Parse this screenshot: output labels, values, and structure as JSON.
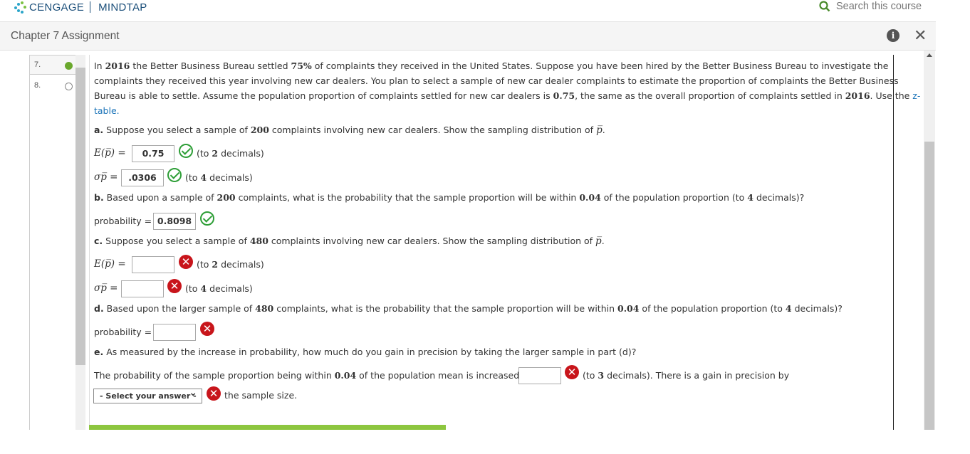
{
  "header": {
    "brand": "CENGAGE",
    "product": "MINDTAP",
    "search_placeholder": "Search this course"
  },
  "assignment": {
    "title": "Chapter 7 Assignment"
  },
  "nav": {
    "items": [
      {
        "number": "7.",
        "status": "complete"
      },
      {
        "number": "8.",
        "status": "incomplete"
      }
    ]
  },
  "question": {
    "intro": {
      "line1_a": "In ",
      "y1": "2016",
      "line1_b": " the Better Business Bureau settled ",
      "p1": "75%",
      "line1_c": " of complaints they received in the United States. Suppose you have been hired by the Better Business Bureau to investigate the",
      "line2": "complaints they received this year involving new car dealers. You plan to select a sample of new car dealer complaints to estimate the proportion of complaints the Better Business",
      "line3_a": "Bureau is able to settle. Assume the population proportion of complaints settled for new car dealers is ",
      "p2": "0.75",
      "line3_b": ", the same as the overall proportion of complaints settled in ",
      "y2": "2016",
      "line3_c": ". Use the ",
      "z": "z-",
      "line4": "table."
    },
    "part_a": {
      "prefix": "a.",
      "text": " Suppose you select a sample of ",
      "n": "200",
      "text2": " complaints involving new car dealers. Show the sampling distribution of ",
      "pbar": "p̅",
      "end": ".",
      "e_label": "E(p̅) =",
      "e_value": "0.75",
      "e_hint_a": "(to ",
      "e_hint_n": "2",
      "e_hint_b": " decimals)",
      "s_label": "σp̅ =",
      "s_value": ".0306",
      "s_hint_a": "(to ",
      "s_hint_n": "4",
      "s_hint_b": " decimals)"
    },
    "part_b": {
      "prefix": "b.",
      "text": " Based upon a sample of ",
      "n": "200",
      "text2": " complaints, what is the probability that the sample proportion will be within ",
      "d": "0.04",
      "text3": " of the population proportion (to ",
      "dec": "4",
      "text4": " decimals)?",
      "p_label": "probability =",
      "p_value": "0.8098"
    },
    "part_c": {
      "prefix": "c.",
      "text": " Suppose you select a sample of ",
      "n": "480",
      "text2": " complaints involving new car dealers. Show the sampling distribution of ",
      "pbar": "p̅",
      "end": ".",
      "e_label": "E(p̅) =",
      "e_value": "",
      "e_hint_a": "(to ",
      "e_hint_n": "2",
      "e_hint_b": " decimals)",
      "s_label": "σp̅ =",
      "s_value": "",
      "s_hint_a": "(to ",
      "s_hint_n": "4",
      "s_hint_b": " decimals)"
    },
    "part_d": {
      "prefix": "d.",
      "text": " Based upon the larger sample of ",
      "n": "480",
      "text2": " complaints, what is the probability that the sample proportion will be within ",
      "d": "0.04",
      "text3": " of the population proportion (to ",
      "dec": "4",
      "text4": " decimals)?",
      "p_label": "probability =",
      "p_value": ""
    },
    "part_e": {
      "prefix": "e.",
      "text": " As measured by the increase in probability, how much do you gain in precision by taking the larger sample in part (d)?",
      "sent_a": "The probability of the sample proportion being within ",
      "d": "0.04",
      "sent_b": " of the population mean is increased by",
      "hint_a": "(to ",
      "hint_n": "3",
      "hint_b": " decimals). There is a gain in precision by",
      "select_value": "- Select your answer -",
      "tail": "the sample size."
    }
  }
}
